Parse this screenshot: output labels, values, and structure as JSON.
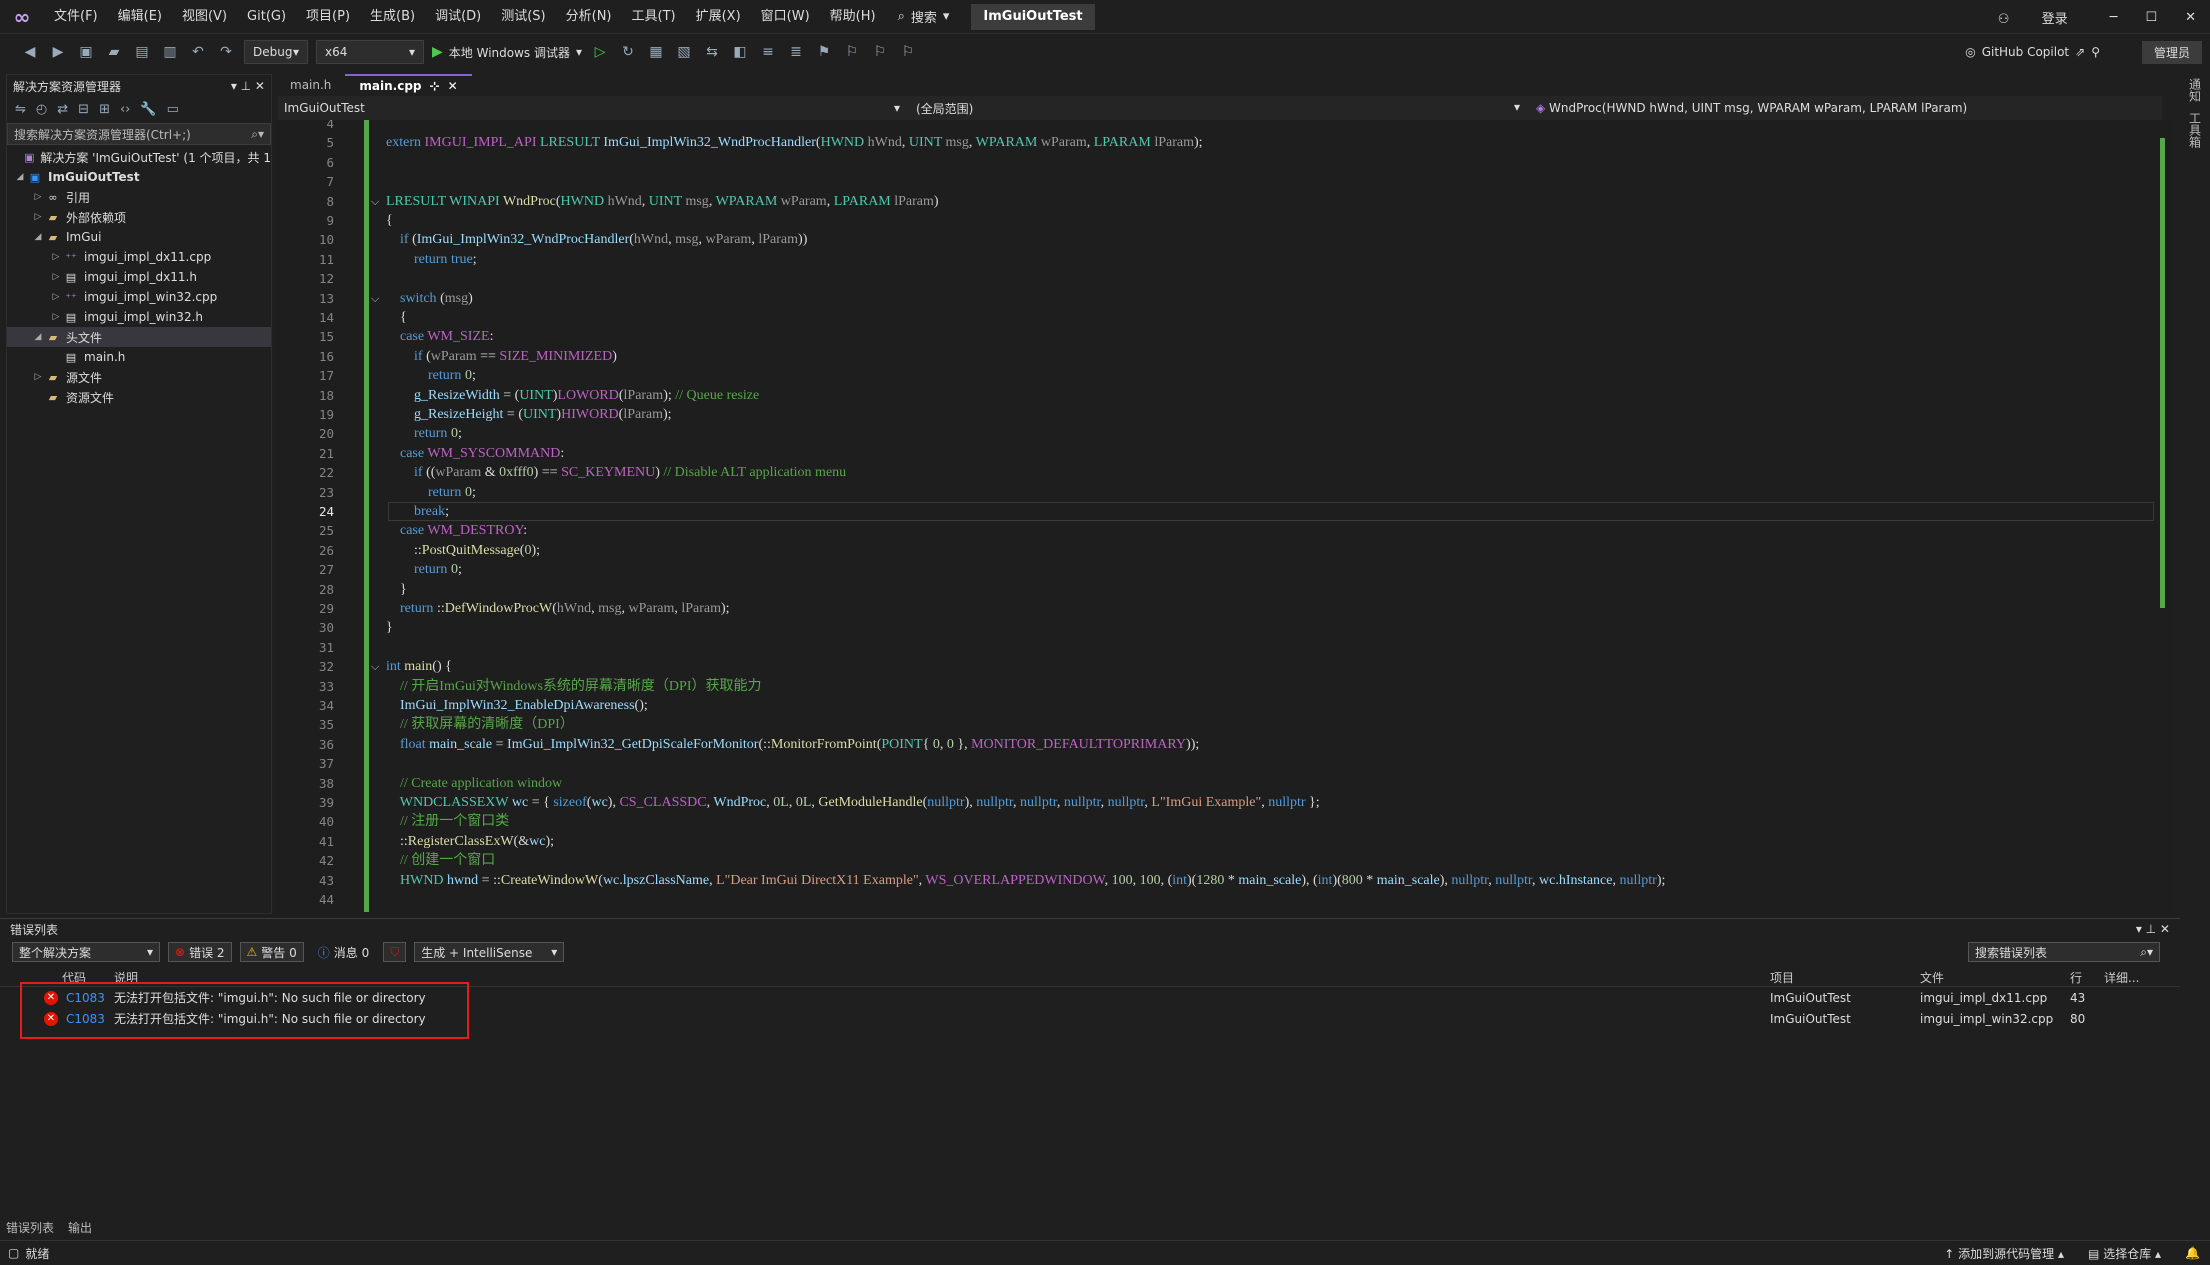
{
  "menubar": {
    "items": [
      "文件(F)",
      "编辑(E)",
      "视图(V)",
      "Git(G)",
      "项目(P)",
      "生成(B)",
      "调试(D)",
      "测试(S)",
      "分析(N)",
      "工具(T)",
      "扩展(X)",
      "窗口(W)",
      "帮助(H)"
    ],
    "search": "搜索",
    "solution_name": "ImGuiOutTest",
    "login": "登录"
  },
  "toolbar": {
    "config": "Debug",
    "platform": "x64",
    "run_label": "本地 Windows 调试器",
    "copilot": "GitHub Copilot",
    "admin": "管理员"
  },
  "solution_explorer": {
    "title": "解决方案资源管理器",
    "search_placeholder": "搜索解决方案资源管理器(Ctrl+;)",
    "items": [
      {
        "label": "解决方案 'ImGuiOutTest' (1 个项目，共 1",
        "indent": 0,
        "arrow": "",
        "icon": "solution"
      },
      {
        "label": "ImGuiOutTest",
        "indent": 0,
        "arrow": "◢",
        "icon": "project",
        "bold": true
      },
      {
        "label": "引用",
        "indent": 1,
        "arrow": "▷",
        "icon": "ref"
      },
      {
        "label": "外部依赖项",
        "indent": 1,
        "arrow": "▷",
        "icon": "folder"
      },
      {
        "label": "ImGui",
        "indent": 1,
        "arrow": "◢",
        "icon": "folder"
      },
      {
        "label": "imgui_impl_dx11.cpp",
        "indent": 2,
        "arrow": "▷",
        "icon": "cpp"
      },
      {
        "label": "imgui_impl_dx11.h",
        "indent": 2,
        "arrow": "▷",
        "icon": "h"
      },
      {
        "label": "imgui_impl_win32.cpp",
        "indent": 2,
        "arrow": "▷",
        "icon": "cpp"
      },
      {
        "label": "imgui_impl_win32.h",
        "indent": 2,
        "arrow": "▷",
        "icon": "h"
      },
      {
        "label": "头文件",
        "indent": 1,
        "arrow": "◢",
        "icon": "folder",
        "selected": true
      },
      {
        "label": "main.h",
        "indent": 2,
        "arrow": "",
        "icon": "h"
      },
      {
        "label": "源文件",
        "indent": 1,
        "arrow": "▷",
        "icon": "folder"
      },
      {
        "label": "资源文件",
        "indent": 1,
        "arrow": "",
        "icon": "folder"
      }
    ]
  },
  "tabs": [
    {
      "label": "main.h",
      "active": false
    },
    {
      "label": "main.cpp",
      "active": true
    }
  ],
  "navbar": {
    "project": "ImGuiOutTest",
    "scope": "(全局范围)",
    "member": "WndProc(HWND hWnd, UINT msg, WPARAM wParam, LPARAM lParam)"
  },
  "editor": {
    "current_line": 24,
    "lines": [
      {
        "n": 4,
        "t": ""
      },
      {
        "n": 5,
        "t": "extern IMGUI_IMPL_API LRESULT ImGui_ImplWin32_WndProcHandler(HWND hWnd, UINT msg, WPARAM wParam, LPARAM lParam);"
      },
      {
        "n": 6,
        "t": ""
      },
      {
        "n": 7,
        "t": ""
      },
      {
        "n": 8,
        "t": "LRESULT WINAPI WndProc(HWND hWnd, UINT msg, WPARAM wParam, LPARAM lParam)"
      },
      {
        "n": 9,
        "t": "{"
      },
      {
        "n": 10,
        "t": "    if (ImGui_ImplWin32_WndProcHandler(hWnd, msg, wParam, lParam))"
      },
      {
        "n": 11,
        "t": "        return true;"
      },
      {
        "n": 12,
        "t": ""
      },
      {
        "n": 13,
        "t": "    switch (msg)"
      },
      {
        "n": 14,
        "t": "    {"
      },
      {
        "n": 15,
        "t": "    case WM_SIZE:"
      },
      {
        "n": 16,
        "t": "        if (wParam == SIZE_MINIMIZED)"
      },
      {
        "n": 17,
        "t": "            return 0;"
      },
      {
        "n": 18,
        "t": "        g_ResizeWidth = (UINT)LOWORD(lParam); // Queue resize"
      },
      {
        "n": 19,
        "t": "        g_ResizeHeight = (UINT)HIWORD(lParam);"
      },
      {
        "n": 20,
        "t": "        return 0;"
      },
      {
        "n": 21,
        "t": "    case WM_SYSCOMMAND:"
      },
      {
        "n": 22,
        "t": "        if ((wParam & 0xfff0) == SC_KEYMENU) // Disable ALT application menu"
      },
      {
        "n": 23,
        "t": "            return 0;"
      },
      {
        "n": 24,
        "t": "        break;"
      },
      {
        "n": 25,
        "t": "    case WM_DESTROY:"
      },
      {
        "n": 26,
        "t": "        ::PostQuitMessage(0);"
      },
      {
        "n": 27,
        "t": "        return 0;"
      },
      {
        "n": 28,
        "t": "    }"
      },
      {
        "n": 29,
        "t": "    return ::DefWindowProcW(hWnd, msg, wParam, lParam);"
      },
      {
        "n": 30,
        "t": "}"
      },
      {
        "n": 31,
        "t": ""
      },
      {
        "n": 32,
        "t": "int main() {"
      },
      {
        "n": 33,
        "t": "    // 开启ImGui对Windows系统的屏幕清晰度（DPI）获取能力"
      },
      {
        "n": 34,
        "t": "    ImGui_ImplWin32_EnableDpiAwareness();"
      },
      {
        "n": 35,
        "t": "    // 获取屏幕的清晰度（DPI）"
      },
      {
        "n": 36,
        "t": "    float main_scale = ImGui_ImplWin32_GetDpiScaleForMonitor(::MonitorFromPoint(POINT{ 0, 0 }, MONITOR_DEFAULTTOPRIMARY));"
      },
      {
        "n": 37,
        "t": ""
      },
      {
        "n": 38,
        "t": "    // Create application window"
      },
      {
        "n": 39,
        "t": "    WNDCLASSEXW wc = { sizeof(wc), CS_CLASSDC, WndProc, 0L, 0L, GetModuleHandle(nullptr), nullptr, nullptr, nullptr, nullptr, L\"ImGui Example\", nullptr };"
      },
      {
        "n": 40,
        "t": "    // 注册一个窗口类"
      },
      {
        "n": 41,
        "t": "    ::RegisterClassExW(&wc);"
      },
      {
        "n": 42,
        "t": "    // 创建一个窗口"
      },
      {
        "n": 43,
        "t": "    HWND hwnd = ::CreateWindowW(wc.lpszClassName, L\"Dear ImGui DirectX11 Example\", WS_OVERLAPPEDWINDOW, 100, 100, (int)(1280 * main_scale), (int)(800 * main_scale), nullptr, nullptr, wc.hInstance, nullptr);"
      },
      {
        "n": 44,
        "t": ""
      }
    ]
  },
  "error_list": {
    "title": "错误列表",
    "scope": "整个解决方案",
    "errors_label": "错误 2",
    "warnings_label": "警告 0",
    "messages_label": "消息 0",
    "build_filter": "生成 + IntelliSense",
    "search_placeholder": "搜索错误列表",
    "columns": {
      "code": "代码",
      "desc": "说明",
      "project": "项目",
      "file": "文件",
      "line": "行",
      "detail": "详细..."
    },
    "rows": [
      {
        "code": "C1083",
        "desc": "无法打开包括文件: \"imgui.h\": No such file or directory",
        "project": "ImGuiOutTest",
        "file": "imgui_impl_dx11.cpp",
        "line": "43"
      },
      {
        "code": "C1083",
        "desc": "无法打开包括文件: \"imgui.h\": No such file or directory",
        "project": "ImGuiOutTest",
        "file": "imgui_impl_win32.cpp",
        "line": "80"
      }
    ]
  },
  "bottom_tabs": [
    "错误列表",
    "输出"
  ],
  "status": {
    "ready": "就绪",
    "source_control": "添加到源代码管理",
    "repo": "选择仓库"
  },
  "right_dock": [
    "通知",
    "工具箱"
  ]
}
